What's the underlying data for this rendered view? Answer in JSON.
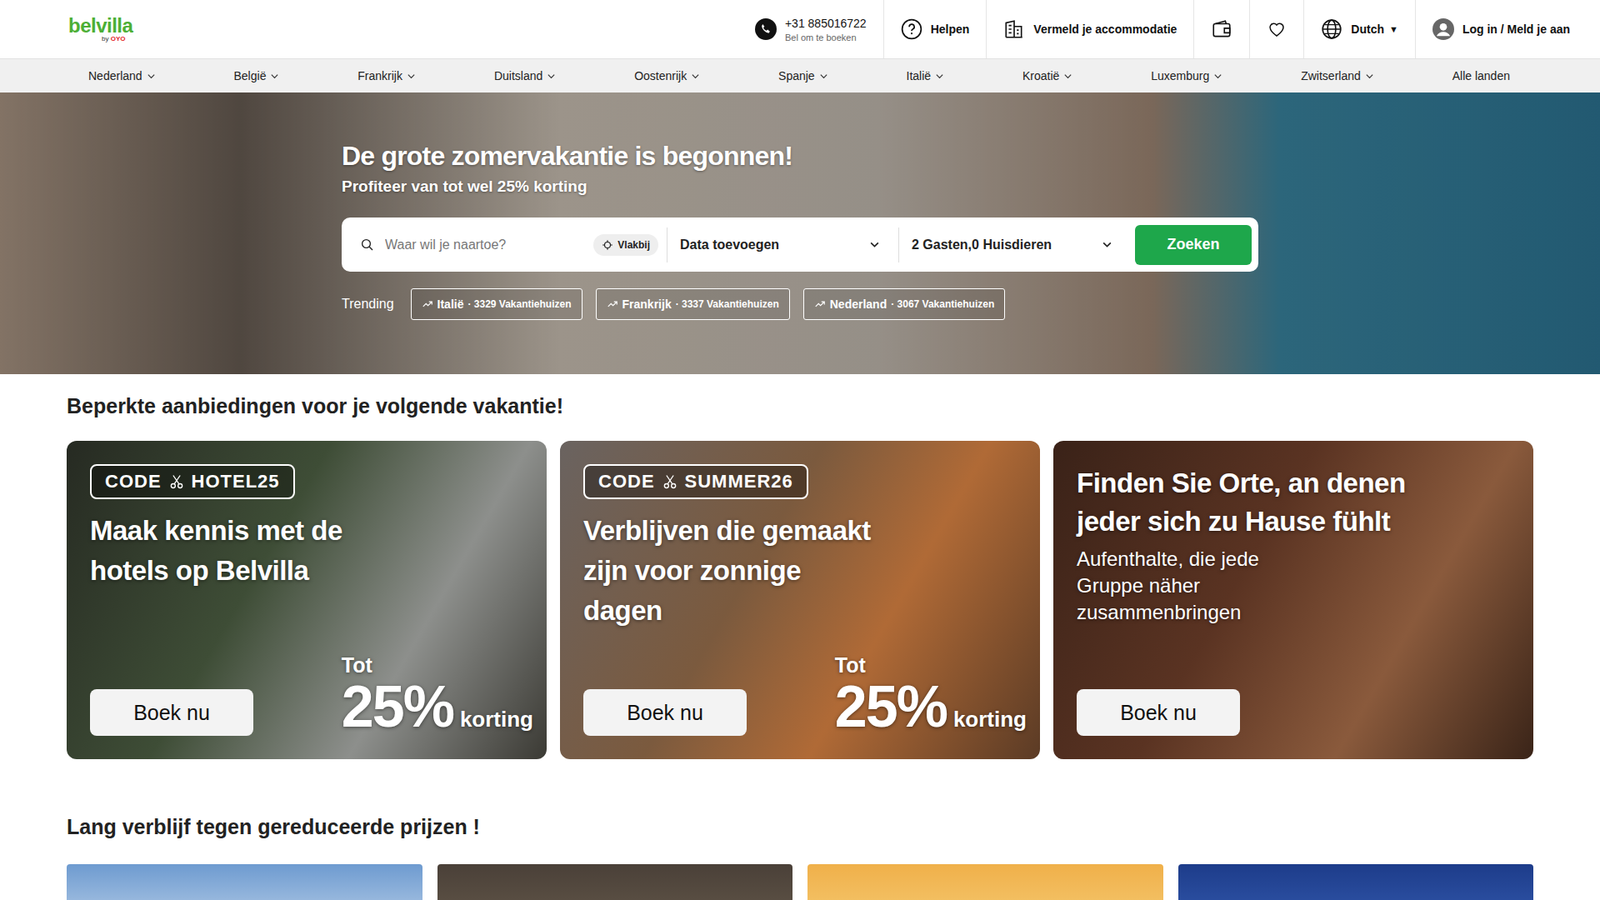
{
  "logo": {
    "name": "belvilla",
    "by": "by",
    "brand": "OYO"
  },
  "header": {
    "phone": "+31 885016722",
    "phone_note": "Bel om te boeken",
    "help": "Helpen",
    "list": "Vermeld je accommodatie",
    "language": "Dutch",
    "language_caret": "▼",
    "login": "Log in / Meld je aan"
  },
  "countries": [
    {
      "label": "Nederland",
      "dropdown": true
    },
    {
      "label": "België",
      "dropdown": true
    },
    {
      "label": "Frankrijk",
      "dropdown": true
    },
    {
      "label": "Duitsland",
      "dropdown": true
    },
    {
      "label": "Oostenrijk",
      "dropdown": true
    },
    {
      "label": "Spanje",
      "dropdown": true
    },
    {
      "label": "Italië",
      "dropdown": true
    },
    {
      "label": "Kroatië",
      "dropdown": true
    },
    {
      "label": "Luxemburg",
      "dropdown": true
    },
    {
      "label": "Zwitserland",
      "dropdown": true
    },
    {
      "label": "Alle landen",
      "dropdown": false
    }
  ],
  "hero": {
    "title": "De grote zomervakantie is begonnen!",
    "subtitle": "Profiteer van tot wel 25% korting"
  },
  "search": {
    "placeholder": "Waar wil je naartoe?",
    "nearby": "Vlakbij",
    "dates": "Data toevoegen",
    "guests": "2 Gasten,0 Huisdieren",
    "button": "Zoeken"
  },
  "trending": {
    "label": "Trending",
    "items": [
      {
        "name": "Italië",
        "count": "· 3329 Vakantiehuizen"
      },
      {
        "name": "Frankrijk",
        "count": "· 3337 Vakantiehuizen"
      },
      {
        "name": "Nederland",
        "count": "· 3067 Vakantiehuizen"
      }
    ]
  },
  "offers": {
    "title": "Beperkte aanbiedingen voor je volgende vakantie!",
    "cards": [
      {
        "code_label": "CODE",
        "code": "HOTEL25",
        "title": "Maak kennis met de hotels op Belvilla",
        "subtitle": "",
        "pre": "Tot",
        "discount": "25%",
        "post": "korting",
        "button": "Boek nu"
      },
      {
        "code_label": "CODE",
        "code": "SUMMER26",
        "title": "Verblijven die gemaakt zijn voor zonnige dagen",
        "subtitle": "",
        "pre": "Tot",
        "discount": "25%",
        "post": "korting",
        "button": "Boek nu"
      },
      {
        "code_label": "",
        "code": "",
        "title": "Finden Sie Orte, an denen jeder sich zu Hause fühlt",
        "subtitle": "Aufenthalte, die jede Gruppe näher zusammenbringen",
        "pre": "",
        "discount": "",
        "post": "",
        "button": "Boek nu"
      }
    ]
  },
  "long_stay": {
    "title": "Lang verblijf tegen gereduceerde prijzen !",
    "cards": [
      {
        "kind": "photo"
      },
      {
        "kind": "photo"
      },
      {
        "kind": "photo"
      },
      {
        "kind": "photo"
      }
    ]
  }
}
